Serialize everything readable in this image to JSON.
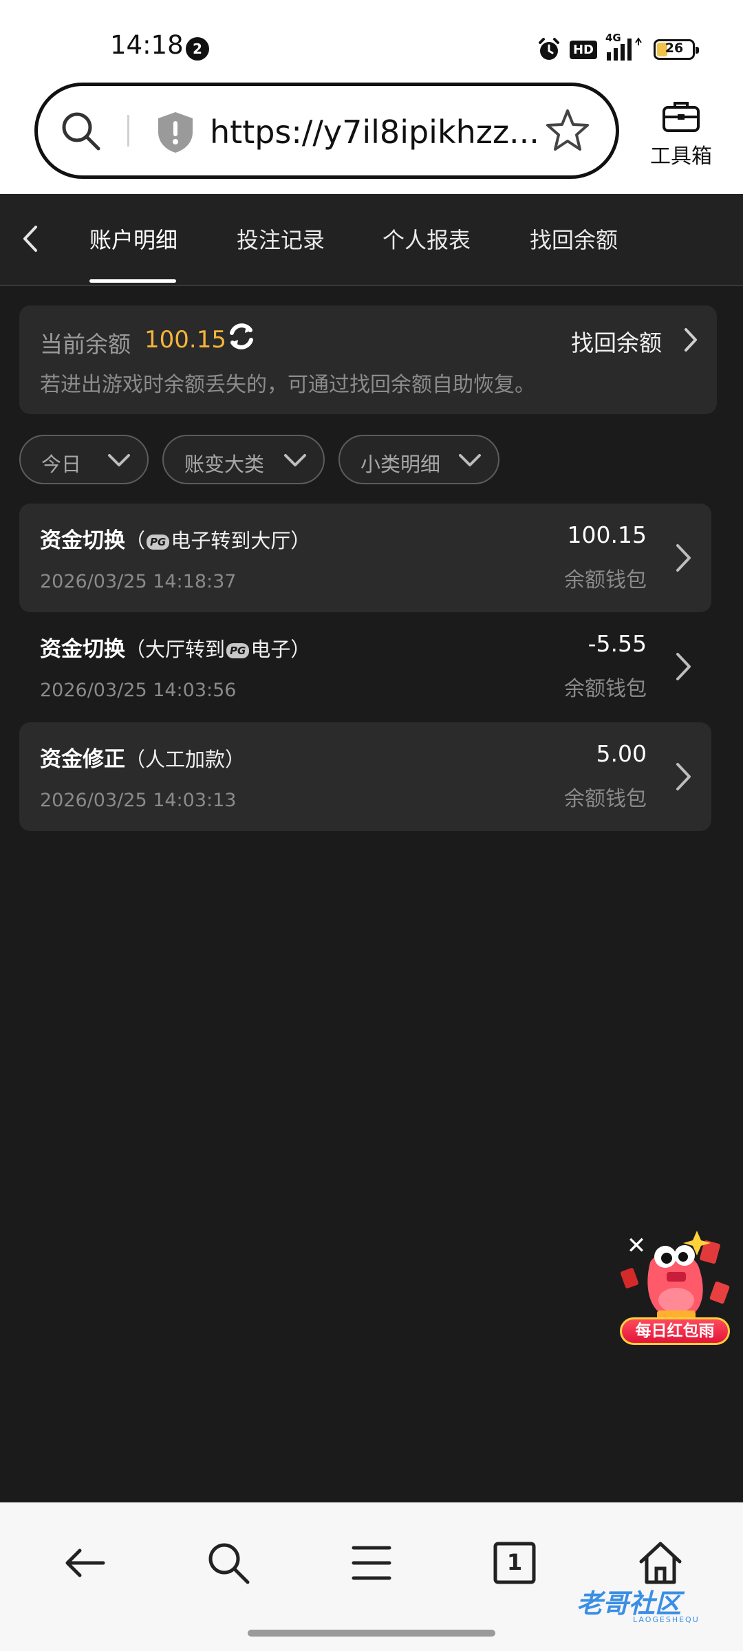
{
  "status_bar": {
    "time": "14:18",
    "notification_count": "2",
    "hd_label": "HD",
    "network_label": "4G",
    "battery_level": "26"
  },
  "browser": {
    "url": "https://y7il8ipikhzz...",
    "toolbox_label": "工具箱"
  },
  "tabs": [
    {
      "label": "账户明细",
      "active": true
    },
    {
      "label": "投注记录",
      "active": false
    },
    {
      "label": "个人报表",
      "active": false
    },
    {
      "label": "找回余额",
      "active": false
    }
  ],
  "balance": {
    "label": "当前余额",
    "amount": "100.15",
    "recover_label": "找回余额",
    "hint": "若进出游戏时余额丢失的，可通过找回余额自助恢复。"
  },
  "filters": [
    {
      "label": "今日"
    },
    {
      "label": "账变大类"
    },
    {
      "label": "小类明细"
    }
  ],
  "transactions": [
    {
      "type": "资金切换",
      "detail_prefix": "（",
      "detail_logo": "PG",
      "detail_suffix": "电子转到大厅）",
      "time": "2026/03/25 14:18:37",
      "amount": "100.15",
      "wallet": "余额钱包"
    },
    {
      "type": "资金切换",
      "detail_prefix": "（大厅转到",
      "detail_logo": "PG",
      "detail_suffix": "电子）",
      "time": "2026/03/25 14:03:56",
      "amount": "-5.55",
      "wallet": "余额钱包"
    },
    {
      "type": "资金修正",
      "detail_prefix": "（人工加款）",
      "detail_logo": "",
      "detail_suffix": "",
      "time": "2026/03/25 14:03:13",
      "amount": "5.00",
      "wallet": "余额钱包"
    }
  ],
  "promo": {
    "label": "每日红包雨",
    "close_symbol": "✕"
  },
  "bottom_nav": {
    "tab_count": "1"
  },
  "watermark": {
    "text": "老哥社区",
    "sub": "LAOGESHEQU"
  },
  "colors": {
    "background": "#1b1b1b",
    "card": "#2b2b2b",
    "accent_balance": "#f5b53a"
  }
}
